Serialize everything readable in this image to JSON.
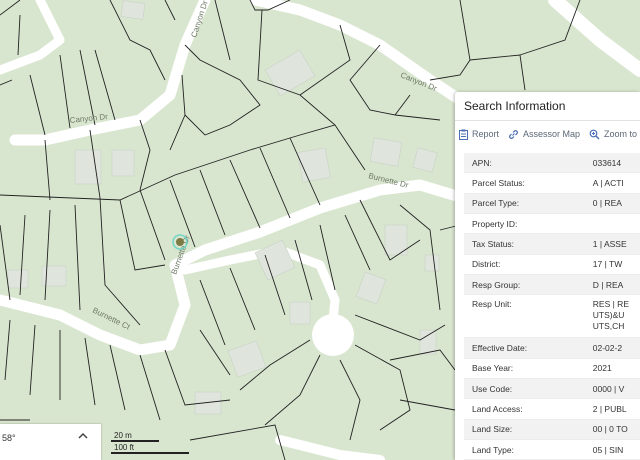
{
  "map": {
    "roads": [
      "Canyon Dr",
      "Canyon Dr",
      "Canyon Dr",
      "Burnette Dr",
      "Burnette Dr",
      "Burnette Ct"
    ],
    "colors": {
      "land": "#d9e6cf",
      "road": "#ffffff",
      "building": "#dfe5dc",
      "parcel_line": "#222222",
      "marker": "#7d7a45",
      "marker_ring": "#5fd1c4"
    }
  },
  "panel": {
    "title": "Search Information",
    "toolbar": {
      "report": "Report",
      "assessor_map": "Assessor Map",
      "zoom_to": "Zoom to"
    },
    "rows": [
      {
        "key": "APN:",
        "value": "033614"
      },
      {
        "key": "Parcel Status:",
        "value": "A | ACTI"
      },
      {
        "key": "Parcel Type:",
        "value": "0 | REA"
      },
      {
        "key": "Property ID:",
        "value": ""
      },
      {
        "key": "Tax Status:",
        "value": "1 | ASSE"
      },
      {
        "key": "District:",
        "value": "17 | TW"
      },
      {
        "key": "Resp Group:",
        "value": "D | REA"
      },
      {
        "key": "Resp Unit:",
        "value": "RES | RE\nUTS)&U\nUTS,CH"
      },
      {
        "key": "Effective Date:",
        "value": "02-02-2"
      },
      {
        "key": "Base Year:",
        "value": "2021"
      },
      {
        "key": "Use Code:",
        "value": "0000 | V"
      },
      {
        "key": "Land Access:",
        "value": "2 | PUBL"
      },
      {
        "key": "Land Size:",
        "value": "00 | 0 TO"
      },
      {
        "key": "Land Type:",
        "value": "05 | SIN"
      }
    ]
  },
  "orientation": {
    "text": "58°"
  },
  "scale": {
    "metric": "20 m",
    "imperial": "100 ft"
  }
}
